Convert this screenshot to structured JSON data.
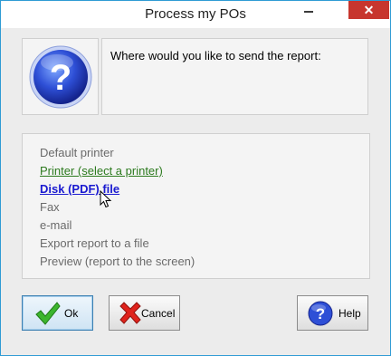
{
  "window": {
    "title": "Process my POs",
    "minimize_glyph": "—",
    "close_glyph": "✕"
  },
  "message": {
    "icon": "question-icon",
    "text": "Where would you like to send the report:"
  },
  "options": {
    "items": [
      {
        "label": "Default printer",
        "state": "normal"
      },
      {
        "label": "Printer (select a printer)",
        "state": "hover"
      },
      {
        "label": "Disk (PDF) file",
        "state": "selected"
      },
      {
        "label": "Fax",
        "state": "normal"
      },
      {
        "label": "e-mail",
        "state": "normal"
      },
      {
        "label": "Export report to a file",
        "state": "normal"
      },
      {
        "label": "Preview (report to the screen)",
        "state": "normal"
      }
    ]
  },
  "buttons": {
    "ok": {
      "label": "Ok",
      "icon": "checkmark-icon"
    },
    "cancel": {
      "label": "Cancel",
      "icon": "x-cross-icon"
    },
    "help": {
      "label": "Help",
      "icon": "help-question-icon"
    }
  },
  "colors": {
    "window_border": "#2f9bd4",
    "close_button": "#c7362e",
    "hover_option": "#2c7a1e",
    "selected_option": "#1a1ad0",
    "normal_option": "#6a6a6a"
  }
}
